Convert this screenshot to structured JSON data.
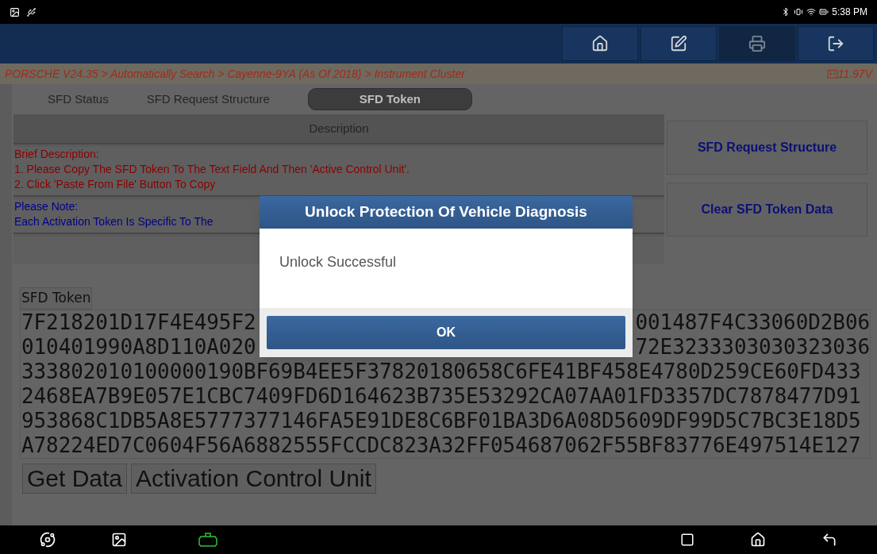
{
  "status_bar": {
    "time": "5:38 PM"
  },
  "toolbar": [
    {
      "kind": "home",
      "disabled": false
    },
    {
      "kind": "edit",
      "disabled": false
    },
    {
      "kind": "print",
      "disabled": true
    },
    {
      "kind": "exit",
      "disabled": false
    }
  ],
  "breadcrumb": {
    "path": "PORSCHE V24.35 > Automatically Search > Cayenne-9YA (As Of 2018) > Instrument Cluster",
    "voltage": "11.97V"
  },
  "tabs": [
    {
      "label": "SFD Status",
      "selected": false
    },
    {
      "label": "SFD Request Structure",
      "selected": false
    },
    {
      "label": "SFD Token",
      "selected": true
    }
  ],
  "description": {
    "header": "Description",
    "sections": [
      {
        "color": "#8b0000",
        "lines": [
          "Brief Description:",
          "1. Please Copy The SFD Token To The Text Field And Then 'Active Control Unit'.",
          "2. Click 'Paste From File' Button To Copy"
        ]
      },
      {
        "color": "#00008b",
        "lines": [
          "Please Note:",
          "Each Activation Token Is Specific To The"
        ]
      }
    ]
  },
  "side_buttons": [
    "SFD Request Structure",
    "Clear SFD Token Data"
  ],
  "token": {
    "label": "SFD Token",
    "lines": [
      {
        "left": "7F218201D17F4E495F2",
        "right": "001487F4C33060D2B06"
      },
      {
        "left": "010401990A8D110A020",
        "right": "72E3233303030323036"
      },
      {
        "left": "333802010100000190BF69B4EE5F37820180658C6FE41BF458E4780D259CE60FD433"
      },
      {
        "left": "2468EA7B9E057E1CBC7409FD6D164623B735E53292CA07AA01FD3357DC7878477D91"
      },
      {
        "left": "953868C1DB5A8E5777377146FA5E91DE8C6BF01BA3D6A08D5609DF99D5C7BC3E18D5"
      },
      {
        "left": "A78224ED7C0604F56A6882555FCCDC823A32FF054687062F55BF83776E497514E127"
      }
    ]
  },
  "action_buttons": [
    "Get Data",
    "Activation Control Unit"
  ],
  "dialog": {
    "title": "Unlock Protection Of Vehicle Diagnosis",
    "message": "Unlock Successful",
    "button": "OK"
  }
}
